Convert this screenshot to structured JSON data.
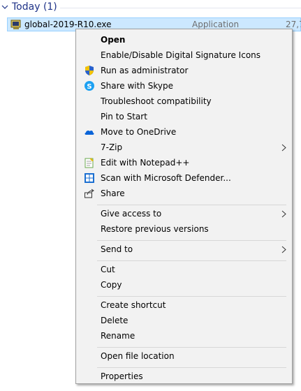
{
  "group": {
    "title": "Today (1)"
  },
  "file": {
    "name": "global-2019-R10.exe",
    "type": "Application",
    "size": "27,7"
  },
  "menu": {
    "items": [
      {
        "label": "Open",
        "bold": true,
        "icon": ""
      },
      {
        "label": "Enable/Disable Digital Signature Icons",
        "icon": ""
      },
      {
        "label": "Run as administrator",
        "icon": "uac-shield-icon"
      },
      {
        "label": "Share with Skype",
        "icon": "skype-icon"
      },
      {
        "label": "Troubleshoot compatibility",
        "icon": ""
      },
      {
        "label": "Pin to Start",
        "icon": ""
      },
      {
        "label": "Move to OneDrive",
        "icon": "onedrive-icon"
      },
      {
        "label": "7-Zip",
        "icon": "",
        "submenu": true
      },
      {
        "label": "Edit with Notepad++",
        "icon": "notepadpp-icon"
      },
      {
        "label": "Scan with Microsoft Defender...",
        "icon": "defender-icon"
      },
      {
        "label": "Share",
        "icon": "share-icon"
      },
      {
        "label": "Give access to",
        "icon": "",
        "submenu": true
      },
      {
        "label": "Restore previous versions",
        "icon": ""
      },
      {
        "label": "Send to",
        "icon": "",
        "submenu": true
      },
      {
        "label": "Cut",
        "icon": ""
      },
      {
        "label": "Copy",
        "icon": ""
      },
      {
        "label": "Create shortcut",
        "icon": ""
      },
      {
        "label": "Delete",
        "icon": ""
      },
      {
        "label": "Rename",
        "icon": ""
      },
      {
        "label": "Open file location",
        "icon": ""
      },
      {
        "label": "Properties",
        "icon": ""
      }
    ]
  }
}
